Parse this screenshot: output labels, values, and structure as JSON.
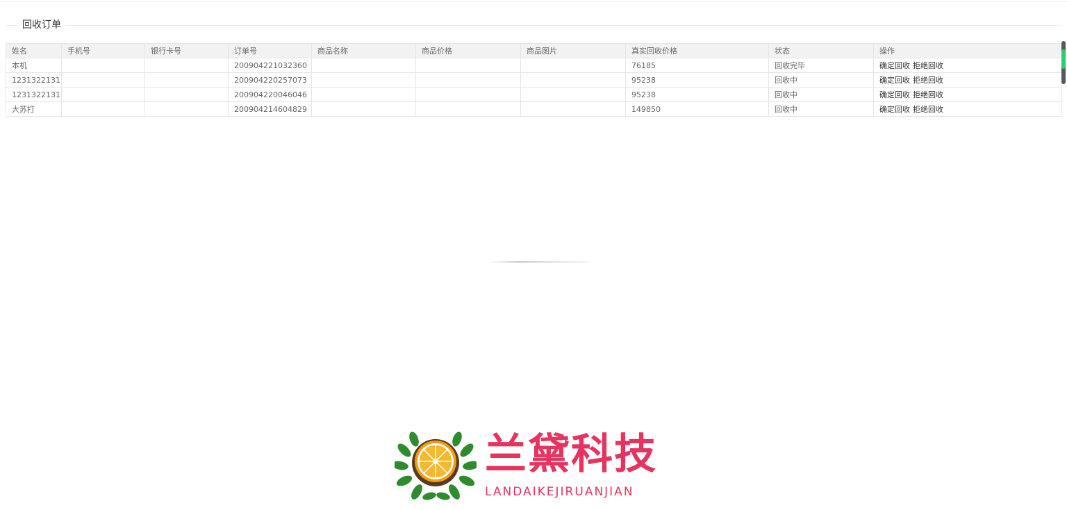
{
  "section": {
    "title": "回收订单"
  },
  "table": {
    "columns": [
      "姓名",
      "手机号",
      "银行卡号",
      "订单号",
      "商品名称",
      "商品价格",
      "商品图片",
      "真实回收价格",
      "状态",
      "操作"
    ],
    "rows": [
      {
        "name": "本机",
        "phone": "",
        "bank_card": "",
        "order_no": "200904221032360",
        "product_name": "",
        "product_price": "",
        "product_image": "",
        "real_price": "76185",
        "status": "回收完毕",
        "confirm": "确定回收",
        "reject": "拒绝回收"
      },
      {
        "name": "1231322131",
        "phone": "",
        "bank_card": "",
        "order_no": "200904220257073",
        "product_name": "",
        "product_price": "",
        "product_image": "",
        "real_price": "95238",
        "status": "回收中",
        "confirm": "确定回收",
        "reject": "拒绝回收"
      },
      {
        "name": "1231322131",
        "phone": "",
        "bank_card": "",
        "order_no": "200904220046046",
        "product_name": "",
        "product_price": "",
        "product_image": "",
        "real_price": "95238",
        "status": "回收中",
        "confirm": "确定回收",
        "reject": "拒绝回收"
      },
      {
        "name": "大苏打",
        "phone": "",
        "bank_card": "",
        "order_no": "200904214604829",
        "product_name": "",
        "product_price": "",
        "product_image": "",
        "real_price": "149850",
        "status": "回收中",
        "confirm": "确定回收",
        "reject": "拒绝回收"
      }
    ]
  },
  "logo": {
    "text_cn": "兰黛科技",
    "text_en": "LANDAIKEJIRUANJIAN",
    "icon": "orange-slice-laurel-icon",
    "brand_color": "#e7345f",
    "leaf_color": "#2e8b2e",
    "fruit_color": "#f5a623"
  },
  "colors": {
    "header_bg": "#f2f2f2",
    "border": "#e6e6e6",
    "scroll_thumb": "#2ecc71"
  }
}
